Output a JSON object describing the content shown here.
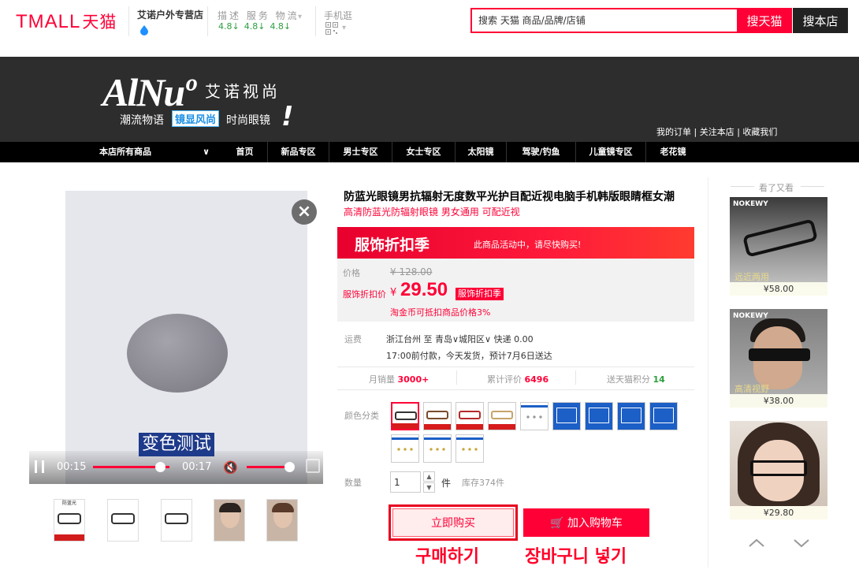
{
  "header": {
    "logo_text": "TMALL",
    "logo_cn": "天猫",
    "store_name": "艾诺户外专营店",
    "rating_labels": "描述 服务 物流",
    "ratings": [
      "4.8↓",
      "4.8↓",
      "4.8↓"
    ],
    "mobile_label": "手机逛",
    "search_placeholder": "搜索 天猫 商品/品牌/店铺",
    "search_tmall_label": "搜天猫",
    "search_store_label": "搜本店"
  },
  "banner": {
    "brand_mark": "AlNuº",
    "brand_cn": "艾诺视尚",
    "slogan1": "潮流物语",
    "slogan2": "镜显风尚",
    "slogan3": "时尚眼镜",
    "links": [
      "我的订单",
      "关注本店",
      "收藏我们"
    ],
    "link_sep": " | "
  },
  "nav": {
    "all_label": "本店所有商品",
    "items": [
      "首页",
      "新品专区",
      "男士专区",
      "女士专区",
      "太阳镜",
      "驾驶/钓鱼",
      "儿童镜专区",
      "老花镜"
    ]
  },
  "video": {
    "caption": "变色测试",
    "time_current": "00:15",
    "time_total": "00:17",
    "progress": 0.88,
    "volume": 0.9
  },
  "thumbs": [
    {
      "top": "防蓝光",
      "kind": "glasses"
    },
    {
      "top": "",
      "kind": "glasses"
    },
    {
      "top": "",
      "kind": "glasses"
    },
    {
      "top": "",
      "kind": "face"
    },
    {
      "top": "",
      "kind": "face"
    }
  ],
  "product": {
    "title": "防蓝光眼镜男抗辐射无度数平光护目配近视电脑手机韩版眼睛框女潮",
    "subtitle": "高清防蓝光防辐射眼镜 男女通用 可配近视",
    "promo_title": "服饰折扣季",
    "promo_note": "此商品活动中，请尽快购买!",
    "price_label": "价格",
    "price_original": "¥ 128.00",
    "promo_price_label": "服饰折扣价",
    "currency": "¥",
    "promo_price": "29.50",
    "promo_tag": "服饰折扣季",
    "coin_note": "淘金币可抵扣商品价格3%",
    "shipping_label": "运费",
    "shipping_line": "浙江台州 至 青岛∨城阳区∨ 快递 0.00",
    "shipping_line2": "17:00前付款，今天发货，预计7月6日送达",
    "stats": {
      "monthly_label": "月销量",
      "monthly_value": "3000+",
      "reviews_label": "累计评价",
      "reviews_value": "6496",
      "points_label": "送天猫积分",
      "points_value": "14"
    },
    "color_label": "颜色分类",
    "quantity_label": "数量",
    "quantity_value": "1",
    "quantity_unit": "件",
    "stock": "库存374件",
    "buy_now_label": "立即购买",
    "add_cart_label": "加入购物车",
    "buy_now_ko": "구매하기",
    "add_cart_ko": "장바구니 넣기"
  },
  "sidebar": {
    "title": "看了又看",
    "items": [
      {
        "brand": "NOKEWY",
        "overlay": "远近两用",
        "price": "¥58.00"
      },
      {
        "brand": "NOKEWY",
        "overlay": "高清视野",
        "price": "¥38.00"
      },
      {
        "brand": "",
        "overlay": "",
        "price": "¥29.80"
      }
    ]
  },
  "colors": {
    "brand_red": "#ff0036",
    "dark": "#2d2d2d",
    "green": "#2e9e3f"
  }
}
